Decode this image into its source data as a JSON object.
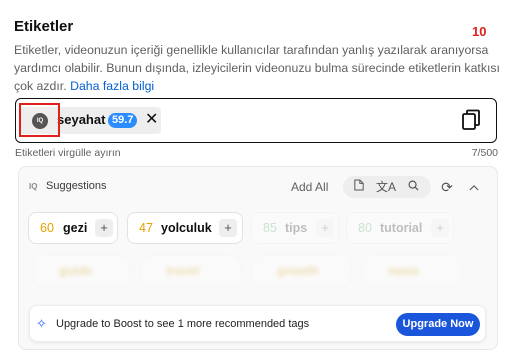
{
  "section": {
    "title": "Etiketler",
    "annotation_number": "10",
    "description": "Etiketler, videonuzun içeriği genellikle kullanıcılar tarafından yanlış yazılarak aranıyorsa yardımcı olabilir. Bunun dışında, izleyicilerin videonuzu bulma sürecinde etiketlerin katkısı çok azdır.",
    "learn_more": "Daha fazla bilgi"
  },
  "tag_input": {
    "chips": [
      {
        "logo": "IQ",
        "label": "seyahat",
        "score": "59.7"
      }
    ],
    "hint": "Etiketleri virgülle ayırın",
    "count": "7/500"
  },
  "suggestions": {
    "title": "Suggestions",
    "iq": "IQ",
    "add_all": "Add All",
    "tools": [
      "document-icon",
      "translate-icon",
      "search-icon",
      "refresh-icon",
      "chevron-up-icon"
    ],
    "items": [
      {
        "score": "60",
        "label": "gezi",
        "score_color": "#e6a100"
      },
      {
        "score": "47",
        "label": "yolculuk",
        "score_color": "#e6a100"
      },
      {
        "score": "85",
        "label": "tips",
        "score_color": "#34a853"
      },
      {
        "score": "80",
        "label": "tutorial",
        "score_color": "#34a853"
      }
    ],
    "blurred_items": [
      "guide",
      "travel",
      "growth",
      "news"
    ]
  },
  "upgrade": {
    "text": "Upgrade to Boost to see 1 more recommended tags",
    "button": "Upgrade Now"
  },
  "colors": {
    "accent": "#1a56db",
    "score_badge": "#2b8cff",
    "annotation": "#e0201b"
  }
}
